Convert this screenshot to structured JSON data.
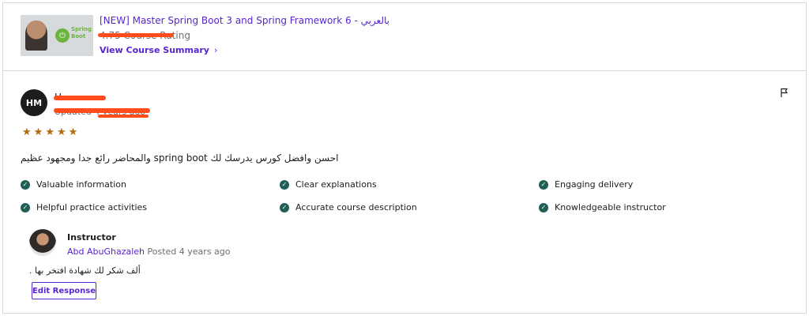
{
  "course": {
    "title": "[NEW] Master Spring Boot 3 and Spring Framework 6 - بالعربي",
    "rating_text": "4.75 Course Rating",
    "view_summary_label": "View Course Summary",
    "thumbnail": {
      "logo_text": "Spring Boot",
      "logo_color": "#6db33f"
    }
  },
  "review": {
    "avatar_initials": "HM",
    "reviewer_name": "H",
    "date_text": "Updated 4 years ago",
    "rating": 5,
    "stars": [
      "★",
      "★",
      "★",
      "★",
      "★"
    ],
    "text": "احسن وافضل كورس يدرسك لك spring boot والمحاضر رائع جدا ومجهود عظيم",
    "flag_icon": "flag-icon"
  },
  "tags": [
    "Valuable information",
    "Clear explanations",
    "Engaging delivery",
    "Helpful practice activities",
    "Accurate course description",
    "Knowledgeable instructor"
  ],
  "response": {
    "label": "Instructor",
    "name": "Abd AbuGhazaleh",
    "posted": "Posted 4 years ago",
    "text": "ألف شكر لك شهادة افتخر بها .",
    "edit_label": "Edit Response"
  },
  "colors": {
    "accent": "#5624d0",
    "star": "#b4690e",
    "check": "#1e6055",
    "redaction": "#ff4c1a",
    "border": "#d1d7dc"
  }
}
